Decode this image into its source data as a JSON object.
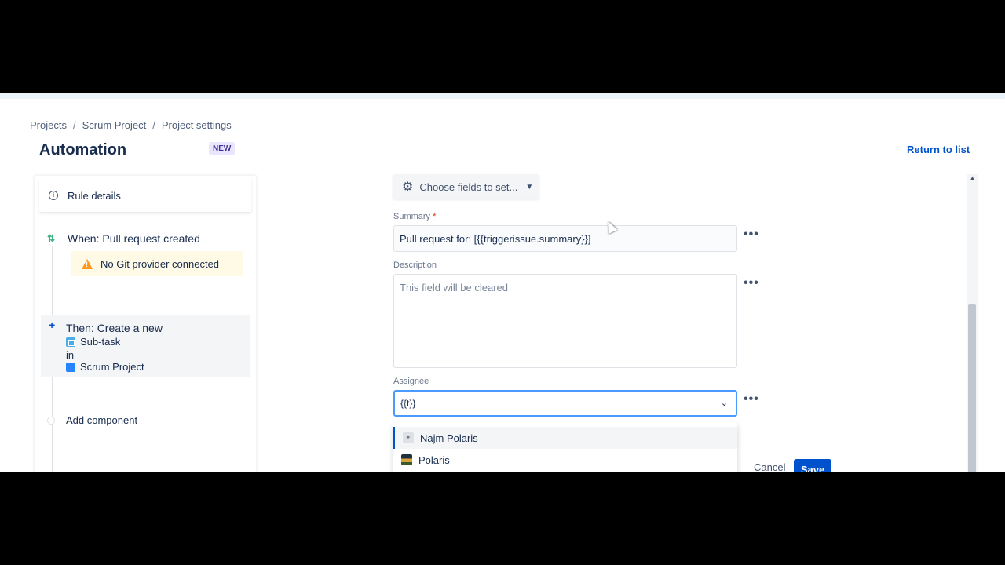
{
  "breadcrumb": [
    "Projects",
    "Scrum Project",
    "Project settings"
  ],
  "header": {
    "title": "Automation",
    "badge": "NEW",
    "return_label": "Return to list"
  },
  "sidebar": {
    "rule_details": "Rule details",
    "trigger": "When: Pull request created",
    "warning": "No Git provider connected",
    "action": {
      "title": "Then: Create a new",
      "issue_type": "Sub-task",
      "connector": "in",
      "project": "Scrum Project"
    },
    "add_component": "Add component"
  },
  "config": {
    "choose_fields": "Choose fields to set...",
    "summary": {
      "label": "Summary",
      "required_mark": "*",
      "value": "Pull request for: [{{triggerissue.summary}}]"
    },
    "description": {
      "label": "Description",
      "placeholder": "This field will be cleared"
    },
    "assignee": {
      "label": "Assignee",
      "value": "{{t}}"
    },
    "options": [
      "Najm Polaris",
      "Polaris"
    ],
    "cancel_label": "Cancel",
    "save_label": "Save"
  },
  "icons": {
    "info": "info-icon",
    "git": "git-pull-request-icon",
    "warning": "warning-icon",
    "plus": "plus-icon",
    "subtask": "subtask-icon",
    "project": "project-icon",
    "gear": "gear-icon",
    "more": "more-icon",
    "chevron": "chevron-down-icon"
  },
  "colors": {
    "accent": "#0052cc",
    "warning_bg": "#fffae6",
    "warning_icon": "#ff991f",
    "focus": "#4c9aff"
  }
}
